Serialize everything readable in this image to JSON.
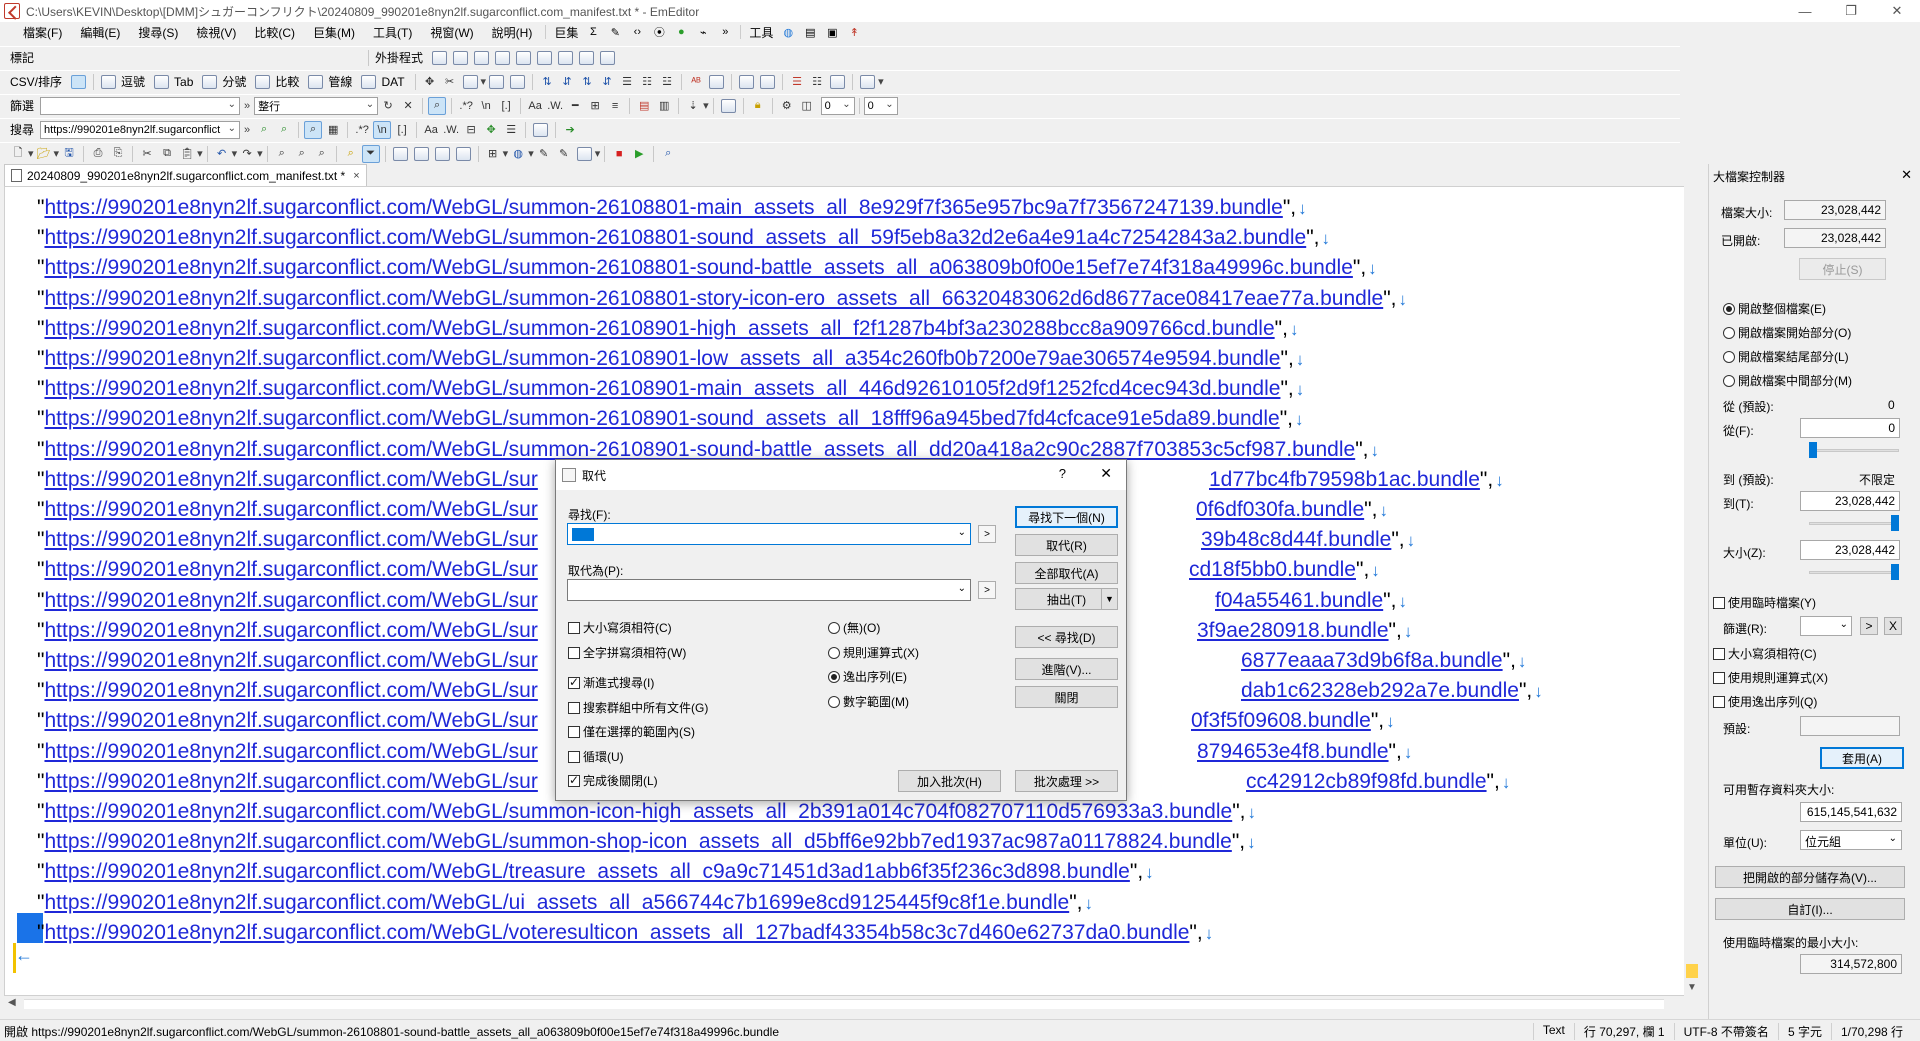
{
  "window": {
    "title": "C:\\Users\\KEVIN\\Desktop\\[DMM]シュガーコンフリクト\\20240809_990201e8nyn2lf.sugarconflict.com_manifest.txt * - EmEditor",
    "minimize": "—",
    "restore": "❐",
    "close": "✕"
  },
  "menu": {
    "items": [
      "檔案(F)",
      "編輯(E)",
      "搜尋(S)",
      "檢視(V)",
      "比較(C)",
      "巨集(M)",
      "工具(T)",
      "視窗(W)",
      "說明(H)"
    ],
    "macros_label": "巨集",
    "sigma": "Σ",
    "more": "»",
    "tools_label": "工具"
  },
  "toolbar_mark": {
    "label": "標記",
    "plugins_label": "外掛程式"
  },
  "toolbar_csv": {
    "label": "CSV/排序",
    "items": [
      "逗號",
      "Tab",
      "分號",
      "比較",
      "管線",
      "DAT"
    ]
  },
  "toolbar_filter": {
    "label": "篩選",
    "combo_value": "",
    "mode_value": "整行",
    "num1": "0",
    "num2": "0"
  },
  "toolbar_search": {
    "label": "搜尋",
    "value": "https://990201e8nyn2lf.sugarconflict"
  },
  "tab": {
    "label": "20240809_990201e8nyn2lf.sugarconflict.com_manifest.txt *",
    "close": "×"
  },
  "editor": {
    "quote": "\"",
    "suffix": "\",",
    "eol": "↓",
    "eof": "←",
    "lines": [
      "https://990201e8nyn2lf.sugarconflict.com/WebGL/summon-26108801-main_assets_all_8e929f7f365e957bc9a7f73567247139.bundle",
      "https://990201e8nyn2lf.sugarconflict.com/WebGL/summon-26108801-sound_assets_all_59f5eb8a32d2e6a4e91a4c72542843a2.bundle",
      "https://990201e8nyn2lf.sugarconflict.com/WebGL/summon-26108801-sound-battle_assets_all_a063809b0f00e15ef7e74f318a49996c.bundle",
      "https://990201e8nyn2lf.sugarconflict.com/WebGL/summon-26108801-story-icon-ero_assets_all_66320483062d6d8677ace08417eae77a.bundle",
      "https://990201e8nyn2lf.sugarconflict.com/WebGL/summon-26108901-high_assets_all_f2f1287b4bf3a230288bcc8a909766cd.bundle",
      "https://990201e8nyn2lf.sugarconflict.com/WebGL/summon-26108901-low_assets_all_a354c260fb0b7200e79ae306574e9594.bundle",
      "https://990201e8nyn2lf.sugarconflict.com/WebGL/summon-26108901-main_assets_all_446d92610105f2d9f1252fcd4cec943d.bundle",
      "https://990201e8nyn2lf.sugarconflict.com/WebGL/summon-26108901-sound_assets_all_18fff96a945bed7fd4cfcace91e5da89.bundle",
      "https://990201e8nyn2lf.sugarconflict.com/WebGL/summon-26108901-sound-battle_assets_all_dd20a418a2c90c2887f703853c5cf987.bundle",
      "https://990201e8nyn2lf.sugarconflict.com/WebGL/sur",
      "https://990201e8nyn2lf.sugarconflict.com/WebGL/sur",
      "https://990201e8nyn2lf.sugarconflict.com/WebGL/sur",
      "https://990201e8nyn2lf.sugarconflict.com/WebGL/sur",
      "https://990201e8nyn2lf.sugarconflict.com/WebGL/sur",
      "https://990201e8nyn2lf.sugarconflict.com/WebGL/sur",
      "https://990201e8nyn2lf.sugarconflict.com/WebGL/sur",
      "https://990201e8nyn2lf.sugarconflict.com/WebGL/sur",
      "https://990201e8nyn2lf.sugarconflict.com/WebGL/sur",
      "https://990201e8nyn2lf.sugarconflict.com/WebGL/sur",
      "https://990201e8nyn2lf.sugarconflict.com/WebGL/sur",
      "https://990201e8nyn2lf.sugarconflict.com/WebGL/summon-icon-high_assets_all_2b391a014c704f082707110d576933a3.bundle",
      "https://990201e8nyn2lf.sugarconflict.com/WebGL/summon-shop-icon_assets_all_d5bff6e92bb7ed1937ac987a01178824.bundle",
      "https://990201e8nyn2lf.sugarconflict.com/WebGL/treasure_assets_all_c9a9c71451d3ad1abb6f35f236c3d898.bundle",
      "https://990201e8nyn2lf.sugarconflict.com/WebGL/ui_assets_all_a566744c7b1699e8cd9125445f9c8f1e.bundle",
      "https://990201e8nyn2lf.sugarconflict.com/WebGL/voteresulticon_assets_all_127badf43354b58c3c7d460e62737da0.bundle"
    ],
    "hidden_tails": [
      "1d77bc4fb79598b1ac.bundle",
      "0f6df030fa.bundle",
      "39b48c8d44f.bundle",
      "cd18f5bb0.bundle",
      "f04a55461.bundle",
      "3f9ae280918.bundle",
      "6877eaaa73d9b6f8a.bundle",
      "dab1c62328eb292a7e.bundle",
      "0f3f5f09608.bundle",
      "8794653e4f8.bundle",
      "cc42912cb89f98fd.bundle"
    ]
  },
  "statusbar": {
    "message": "開啟 https://990201e8nyn2lf.sugarconflict.com/WebGL/summon-26108801-sound-battle_assets_all_a063809b0f00e15ef7e74f318a49996c.bundle",
    "mode": "Text",
    "position": "行 70,297, 欄 1",
    "encoding": "UTF-8 不帶簽名",
    "chars": "5 字元",
    "lines": "1/70,298 行"
  },
  "panel": {
    "title": "大檔案控制器",
    "close": "✕",
    "file_size_label": "檔案大小:",
    "file_size": "23,028,442",
    "opened_label": "已開啟:",
    "opened": "23,028,442",
    "stop_button": "停止(S)",
    "radios": [
      "開啟整個檔案(E)",
      "開啟檔案開始部分(O)",
      "開啟檔案結尾部分(L)",
      "開啟檔案中間部分(M)"
    ],
    "from_default_label": "從 (預設):",
    "from_default": "0",
    "from_label": "從(F):",
    "from": "0",
    "to_default_label": "到 (預設):",
    "to_default": "不限定",
    "to_label": "到(T):",
    "to": "23,028,442",
    "size_label": "大小(Z):",
    "size": "23,028,442",
    "use_temp_label": "使用臨時檔案(Y)",
    "filter_label": "篩選(R):",
    "filter_value": "",
    "filter_next": ">",
    "filter_clear": "X",
    "match_case": "大小寫須相符(C)",
    "use_regex": "使用規則運算式(X)",
    "use_escape": "使用逸出序列(Q)",
    "preset_label": "預設:",
    "preset_value": "",
    "apply_button": "套用(A)",
    "available_label": "可用暫存資料夾大小:",
    "available": "615,145,541,632",
    "unit_label": "單位(U):",
    "unit_value": "位元組",
    "save_part_button": "把開啟的部分儲存為(V)...",
    "custom_button": "自訂(I)...",
    "min_temp_label": "使用臨時檔案的最小大小:",
    "min_temp": "314,572,800"
  },
  "dialog": {
    "title": "取代",
    "help": "?",
    "close": "✕",
    "find_label": "尋找(F):",
    "find_value": "",
    "replace_label": "取代為(P):",
    "replace_value": "",
    "mini_next": ">",
    "buttons": {
      "find_next": "尋找下一個(N)",
      "replace": "取代(R)",
      "replace_all": "全部取代(A)",
      "extract": "抽出(T)",
      "find_prev": "<< 尋找(D)",
      "advanced": "進階(V)...",
      "close": "關閉",
      "add_batch": "加入批次(H)",
      "batch": "批次處理 >>"
    },
    "checks": [
      {
        "label": "大小寫須相符(C)",
        "checked": false
      },
      {
        "label": "全字拼寫須相符(W)",
        "checked": false
      },
      {
        "label": "漸進式搜尋(I)",
        "checked": true
      },
      {
        "label": "搜索群組中所有文件(G)",
        "checked": false
      },
      {
        "label": "僅在選擇的範圍內(S)",
        "checked": false
      },
      {
        "label": "循環(U)",
        "checked": false
      },
      {
        "label": "完成後關閉(L)",
        "checked": true
      }
    ],
    "radios": [
      {
        "label": "(無)(O)",
        "checked": false
      },
      {
        "label": "規則運算式(X)",
        "checked": false
      },
      {
        "label": "逸出序列(E)",
        "checked": true
      },
      {
        "label": "數字範圍(M)",
        "checked": false
      }
    ]
  }
}
